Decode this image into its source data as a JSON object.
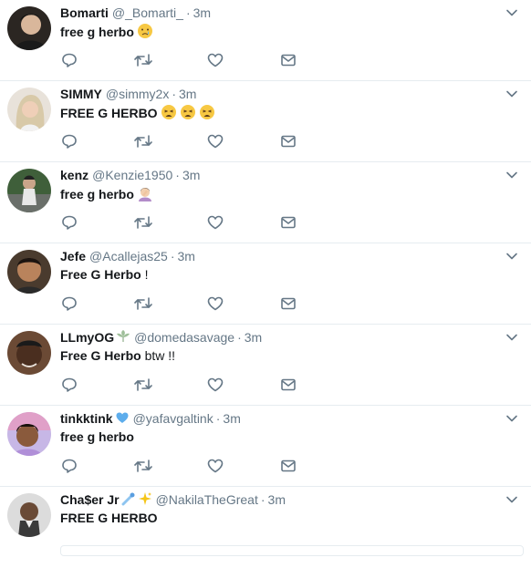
{
  "colors": {
    "text": "#14171a",
    "secondary": "#657786",
    "icon": "#657786",
    "divider": "#e6ecf0"
  },
  "tweets": [
    {
      "name": "Bomarti",
      "handle": "@_Bomarti_",
      "time": "3m",
      "text": "free g herbo",
      "text_rest": "",
      "name_emojis": [],
      "text_emojis": [
        "crying-face"
      ]
    },
    {
      "name": "SIMMY",
      "handle": "@simmy2x",
      "time": "3m",
      "text": "FREE G HERBO",
      "text_rest": "",
      "name_emojis": [],
      "text_emojis": [
        "weary-face",
        "weary-face",
        "weary-face"
      ]
    },
    {
      "name": "kenz",
      "handle": "@Kenzie1950",
      "time": "3m",
      "text": "free g herbo",
      "text_rest": "",
      "name_emojis": [],
      "text_emojis": [
        "person-facepalming"
      ]
    },
    {
      "name": "Jefe",
      "handle": "@Acallejas25",
      "time": "3m",
      "text": "Free G Herbo",
      "text_rest": " !",
      "name_emojis": [],
      "text_emojis": []
    },
    {
      "name": "LLmyOG",
      "handle": "@domedasavage",
      "time": "3m",
      "text": "Free G Herbo",
      "text_rest": " btw !!",
      "name_emojis": [
        "leaf"
      ],
      "text_emojis": []
    },
    {
      "name": "tinkktink",
      "handle": "@yafavgaltink",
      "time": "3m",
      "text": "free g herbo",
      "text_rest": "",
      "name_emojis": [
        "blue-heart"
      ],
      "text_emojis": []
    },
    {
      "name": "Cha$er Jr",
      "handle": "@NakilaTheGreat",
      "time": "3m",
      "text": "FREE G HERBO",
      "text_rest": "",
      "name_emojis": [
        "comet",
        "sparkles"
      ],
      "text_emojis": []
    }
  ],
  "separator": "·"
}
